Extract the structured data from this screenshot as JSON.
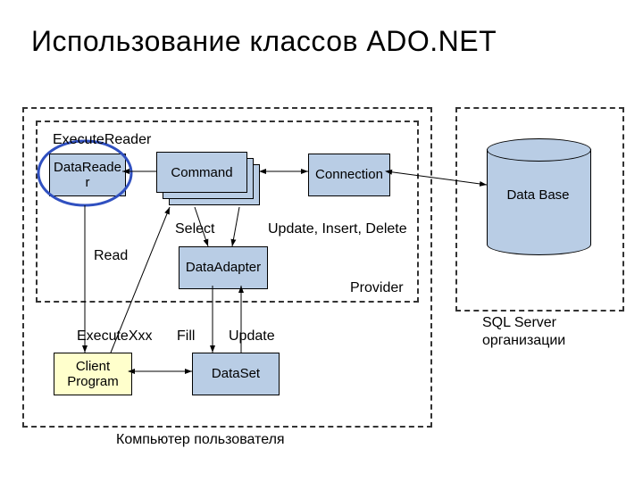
{
  "title": "Использование классов ADO.NET",
  "outerCaption": "Компьютер пользователя",
  "providerLabel": "Provider",
  "rightCaption": "SQL Server организации",
  "boxes": {
    "datareader": "DataReader",
    "command": "Command",
    "connection": "Connection",
    "dataadapter": "DataAdapter",
    "dataset": "DataSet",
    "client": "Client Program",
    "database": "Data Base"
  },
  "labels": {
    "executereader": "ExecuteReader",
    "read": "Read",
    "select": "Select",
    "uid": "Update, Insert, Delete",
    "executexxx": "ExecuteXxx",
    "fill": "Fill",
    "update": "Update"
  }
}
